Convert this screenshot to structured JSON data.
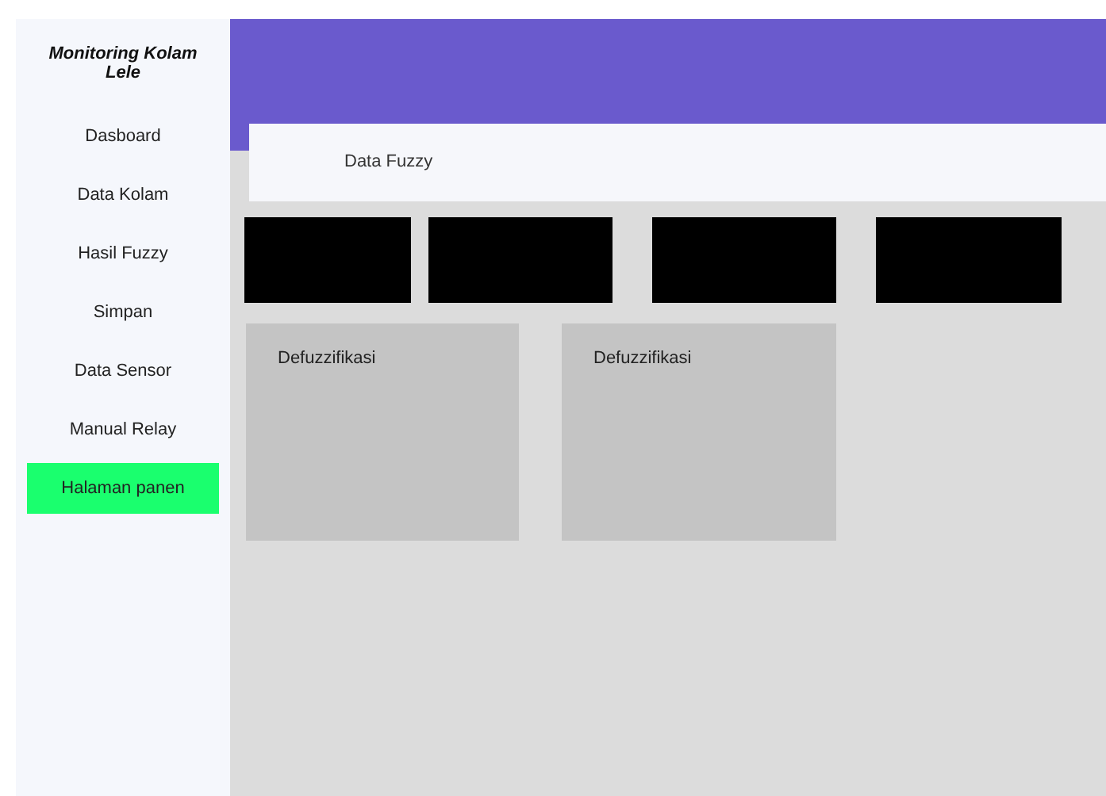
{
  "sidebar": {
    "title": "Monitoring Kolam Lele",
    "items": [
      {
        "label": "Dasboard",
        "selected": false
      },
      {
        "label": "Data Kolam",
        "selected": false
      },
      {
        "label": "Hasil Fuzzy",
        "selected": false
      },
      {
        "label": "Simpan",
        "selected": false
      },
      {
        "label": "Data Sensor",
        "selected": false
      },
      {
        "label": "Manual Relay",
        "selected": false
      },
      {
        "label": "Halaman panen",
        "selected": true
      }
    ]
  },
  "page_title": "Data Fuzzy",
  "cards": [
    {
      "title": "Defuzzifikasi"
    },
    {
      "title": "Defuzzifikasi"
    }
  ]
}
